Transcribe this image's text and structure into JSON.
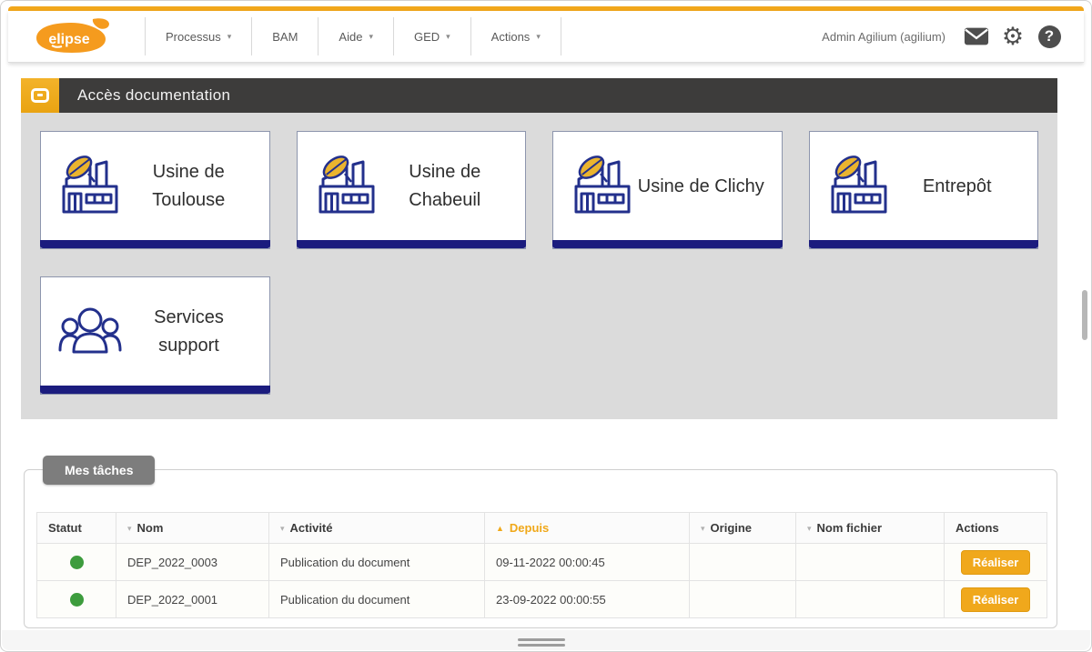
{
  "navbar": {
    "logo_text": "elipse",
    "items": [
      {
        "label": "Processus",
        "caret": "▾"
      },
      {
        "label": "BAM",
        "caret": ""
      },
      {
        "label": "Aide",
        "caret": "▾"
      },
      {
        "label": "GED",
        "caret": "▾"
      },
      {
        "label": "Actions",
        "caret": "▾"
      }
    ],
    "user": "Admin Agilium (agilium)",
    "help_glyph": "?",
    "gear_glyph": "⚙"
  },
  "section_header": {
    "title": "Accès documentation"
  },
  "cards": [
    {
      "label": "Usine de Toulouse",
      "icon": "factory-leaf-icon"
    },
    {
      "label": "Usine de Chabeuil",
      "icon": "factory-leaf-icon"
    },
    {
      "label": "Usine de Clichy",
      "icon": "factory-leaf-icon"
    },
    {
      "label": "Entrepôt",
      "icon": "factory-leaf-icon"
    },
    {
      "label": "Services support",
      "icon": "people-icon"
    }
  ],
  "tasks": {
    "tab_label": "Mes tâches",
    "columns": [
      {
        "label": "Statut",
        "caret": ""
      },
      {
        "label": "Nom",
        "caret": "▾"
      },
      {
        "label": "Activité",
        "caret": "▾"
      },
      {
        "label": "Depuis",
        "caret": "▲"
      },
      {
        "label": "Origine",
        "caret": "▾"
      },
      {
        "label": "Nom fichier",
        "caret": "▾"
      },
      {
        "label": "Actions",
        "caret": ""
      }
    ],
    "rows": [
      {
        "statut": "green",
        "nom": "DEP_2022_0003",
        "activite": "Publication du document",
        "depuis": "09-11-2022 00:00:45",
        "origine": "",
        "nom_fichier": "",
        "action": "Réaliser"
      },
      {
        "statut": "green",
        "nom": "DEP_2022_0001",
        "activite": "Publication du document",
        "depuis": "23-09-2022 00:00:55",
        "origine": "",
        "nom_fichier": "",
        "action": "Réaliser"
      }
    ]
  },
  "colors": {
    "accent_orange": "#f0a81c",
    "navy": "#1b1c7e",
    "header_dark": "#3d3c3b",
    "status_green": "#3d9c3d",
    "content_gray": "#dbdbdb"
  }
}
